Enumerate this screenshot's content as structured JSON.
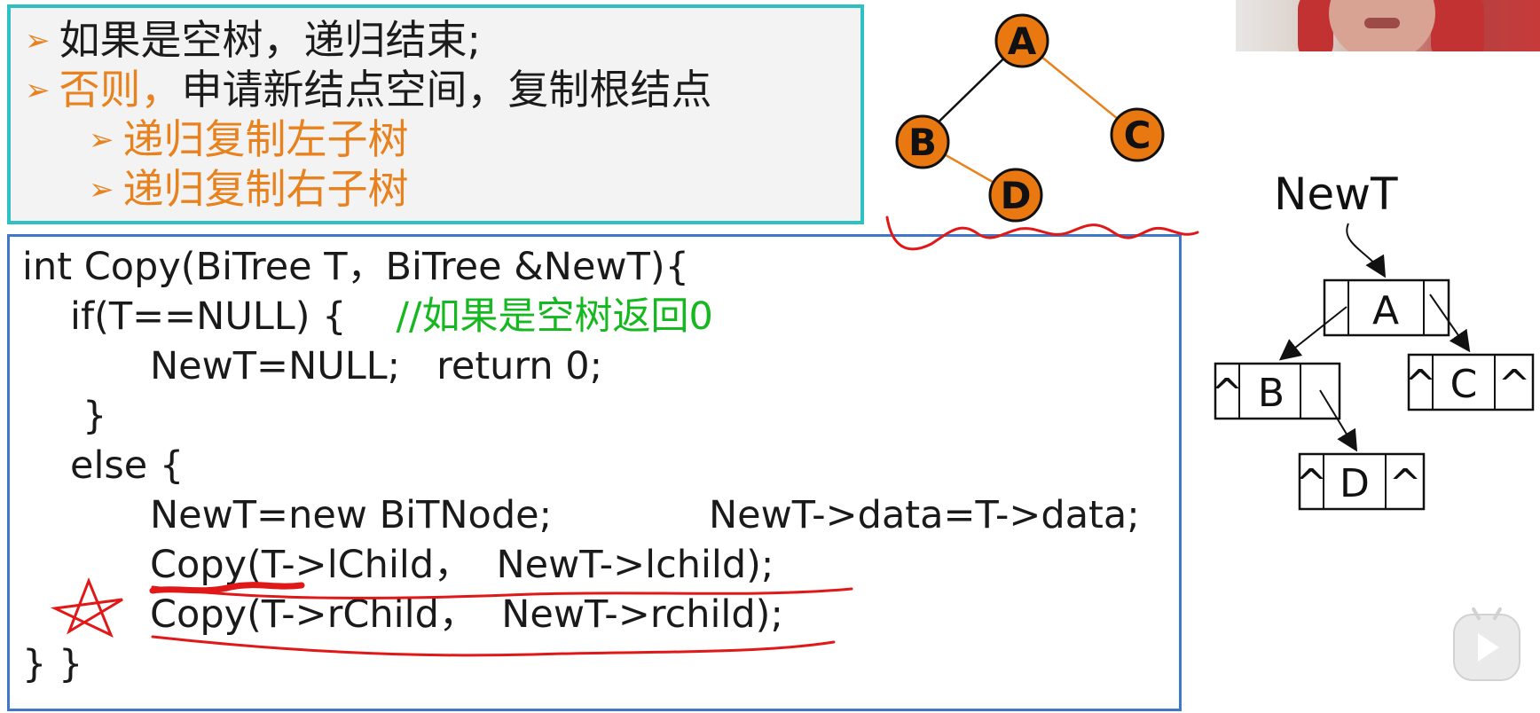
{
  "slide": {
    "bullets": [
      {
        "arrow": "➢",
        "text": "如果是空树，递归结束;"
      },
      {
        "arrow": "➢",
        "highlight": "否则，",
        "text": "申请新结点空间，复制根结点"
      },
      {
        "arrow": "➢",
        "text": "递归复制左子树"
      },
      {
        "arrow": "➢",
        "text": "递归复制右子树"
      }
    ],
    "code": {
      "line1": "int Copy(BiTree T，BiTree &NewT){",
      "line2_code": "if(T==NULL) {",
      "line2_comment": "//如果是空树返回0",
      "line3": "NewT=NULL;   return 0;",
      "line4": "}",
      "line5": "else {",
      "line6a": "NewT=new BiTNode;",
      "line6b": "NewT->data=T->data;",
      "line7": "Copy(T->lChild，  NewT->lchild);",
      "line8": "Copy(T->rChild，  NewT->rchild);",
      "line9": "} }"
    },
    "tree": {
      "nodes": [
        "A",
        "B",
        "C",
        "D"
      ],
      "node_fill": "#e8780f"
    },
    "new_tree": {
      "label": "NewT",
      "root": {
        "left": "",
        "data": "A",
        "right": ""
      },
      "left_child": {
        "left": "^",
        "data": "B",
        "right": ""
      },
      "right_child": {
        "left": "^",
        "data": "C",
        "right": "^"
      },
      "leaf": {
        "left": "^",
        "data": "D",
        "right": "^"
      }
    }
  },
  "colors": {
    "accent_orange": "#e8821e",
    "comment_green": "#16b81f",
    "top_border": "#2fc0c4",
    "code_border": "#3f78c8",
    "annotation_red": "#e01818"
  }
}
